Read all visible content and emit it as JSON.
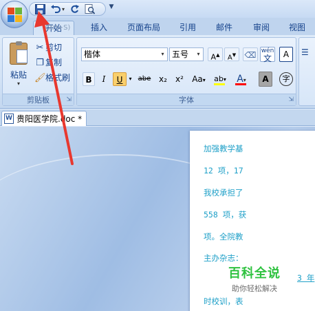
{
  "quick_access": {
    "save_icon": "save-icon",
    "undo_icon": "undo-icon",
    "redo_icon": "redo-icon",
    "preview_icon": "print-preview-icon",
    "more_glyph": "▼"
  },
  "tabs": [
    {
      "label": "开始",
      "active": true
    },
    {
      "label": "插入"
    },
    {
      "label": "页面布局"
    },
    {
      "label": "引用"
    },
    {
      "label": "邮件"
    },
    {
      "label": "审阅"
    },
    {
      "label": "视图"
    }
  ],
  "tooltip": "(Ctrl+S)",
  "clipboard": {
    "paste_label": "粘贴",
    "cut_label": "剪切",
    "copy_label": "复制",
    "format_painter_label": "格式刷",
    "group_label": "剪贴板"
  },
  "font": {
    "font_name": "楷体",
    "font_size": "五号",
    "grow": "A",
    "shrink": "A",
    "phonetic": "wén",
    "phonetic_char": "文",
    "char_border": "A",
    "bold": "B",
    "italic": "I",
    "underline": "U",
    "strike": "abe",
    "subscript": "x₂",
    "superscript": "x²",
    "change_case": "Aa",
    "font_color_letter": "A",
    "shading_letter": "A",
    "enclose_char": "字",
    "group_label": "字体",
    "highlight_color": "#ffff00",
    "font_color": "#ff0000"
  },
  "paragraph": {
    "bullets_glyph": "☰"
  },
  "document": {
    "tab_name": "贵阳医学院.doc *",
    "icon_letter": "W",
    "lines": [
      "加强教学基",
      "12 项，17",
      "我校承担了",
      "558 项，获",
      "项。全院教",
      "主办杂志：",
      "3 年",
      "时校训，表"
    ]
  },
  "watermark": {
    "title": "百科全说",
    "subtitle": "助你轻松解决"
  },
  "colors": {
    "ribbon_text": "#15428b",
    "doc_text": "#1fa0c8",
    "annotation_arrow": "#e8382f",
    "watermark_green": "#2ec23f"
  }
}
